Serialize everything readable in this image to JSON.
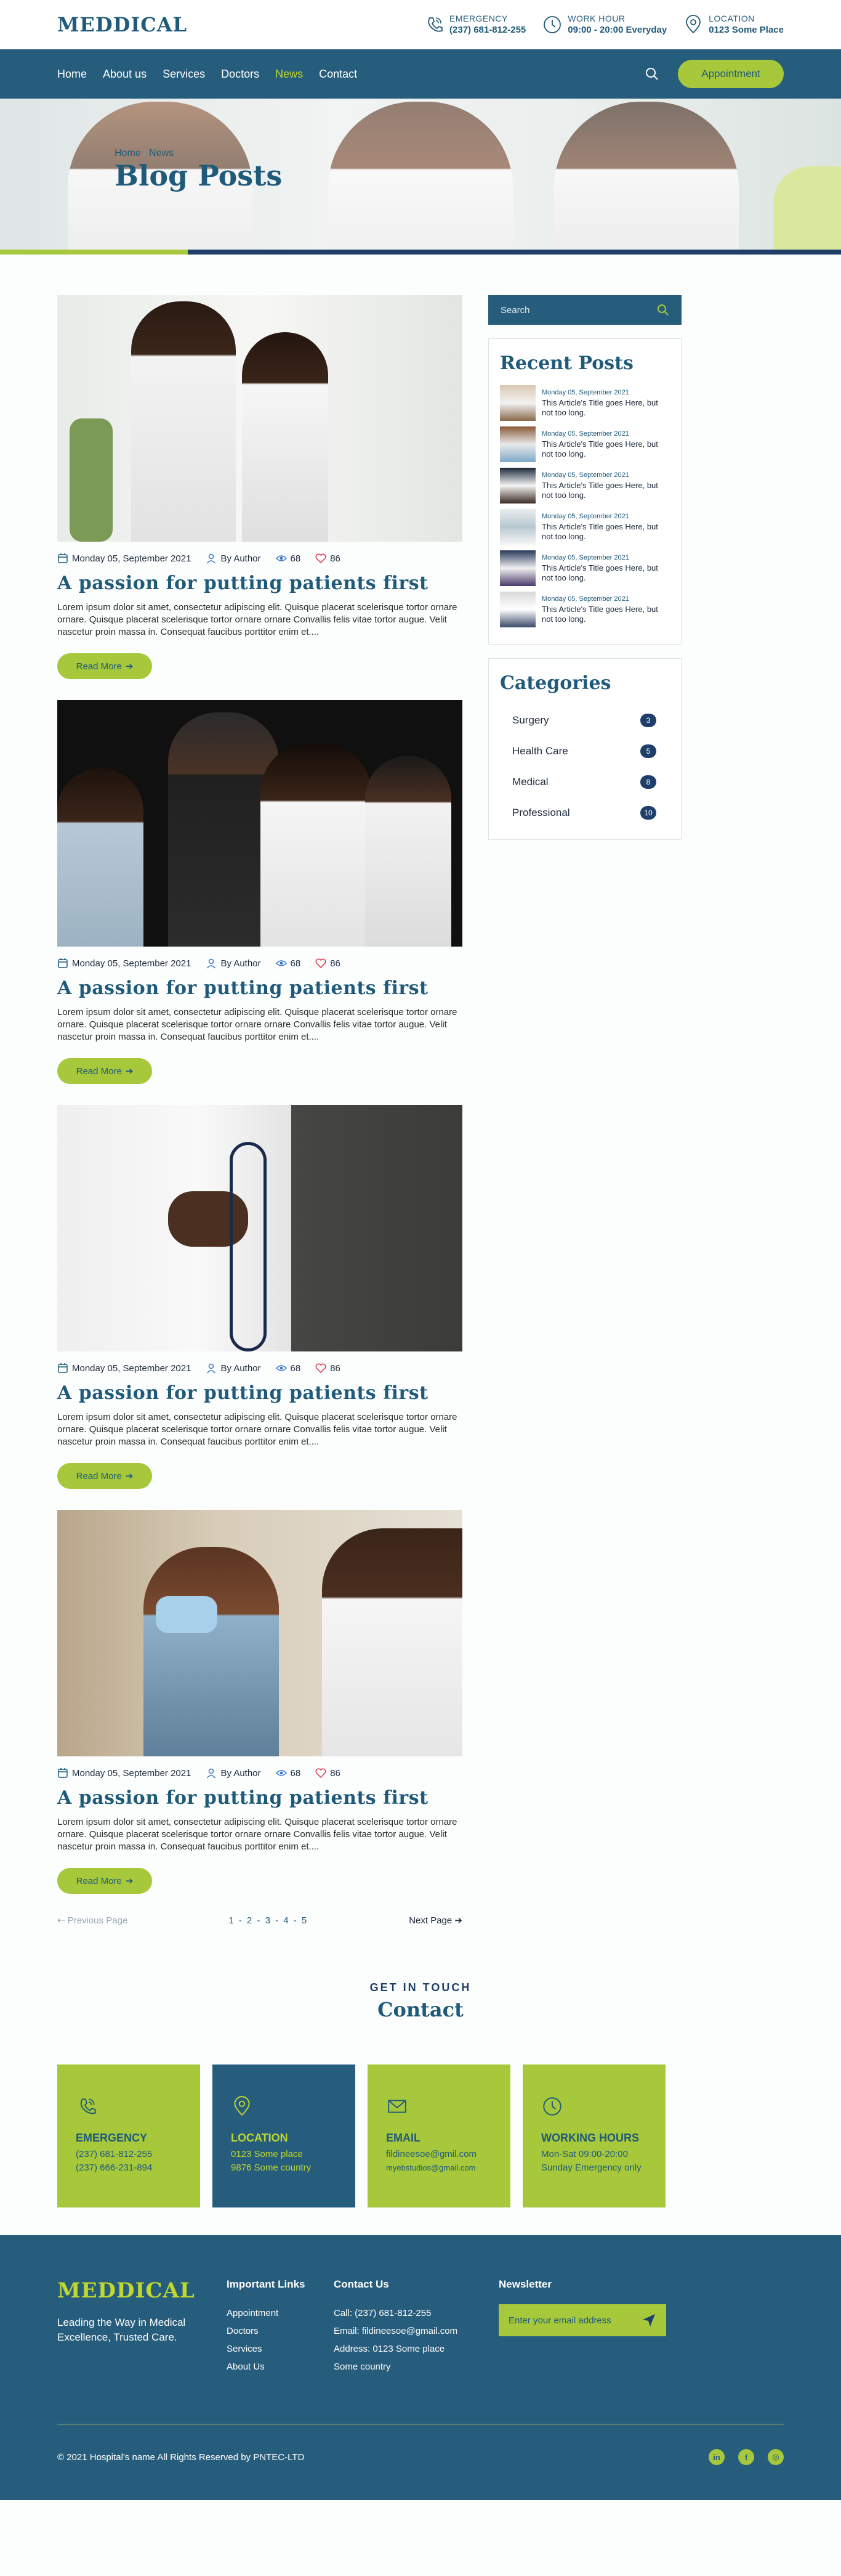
{
  "header": {
    "logo": "MEDDICAL",
    "emergency_title": "EMERGENCY",
    "emergency_value": "(237) 681-812-255",
    "work_title": "WORK HOUR",
    "work_value": "09:00 - 20:00 Everyday",
    "location_title": "LOCATION",
    "location_value": "0123 Some Place"
  },
  "nav": {
    "items": [
      "Home",
      "About us",
      "Services",
      "Doctors",
      "News",
      "Contact"
    ],
    "active": "News",
    "appointment": "Appointment"
  },
  "hero": {
    "crumb_home": "Home",
    "crumb_sep": " / ",
    "crumb_current": "News",
    "title": "Blog Posts"
  },
  "posts": [
    {
      "date": "Monday 05, September 2021",
      "author": "By Author",
      "views": "68",
      "likes": "86",
      "title": "A passion for putting patients first",
      "excerpt": "Lorem ipsum dolor sit amet, consectetur adipiscing elit. Quisque placerat scelerisque tortor ornare ornare. Quisque placerat scelerisque tortor ornare ornare Convallis felis vitae tortor augue. Velit nascetur proin massa in. Consequat faucibus porttitor enim et....",
      "read_more": "Read More"
    },
    {
      "date": "Monday 05, September 2021",
      "author": "By Author",
      "views": "68",
      "likes": "86",
      "title": "A passion for putting patients first",
      "excerpt": "Lorem ipsum dolor sit amet, consectetur adipiscing elit. Quisque placerat scelerisque tortor ornare ornare. Quisque placerat scelerisque tortor ornare ornare Convallis felis vitae tortor augue. Velit nascetur proin massa in. Consequat faucibus porttitor enim et....",
      "read_more": "Read More"
    },
    {
      "date": "Monday 05, September 2021",
      "author": "By Author",
      "views": "68",
      "likes": "86",
      "title": "A passion for putting patients first",
      "excerpt": "Lorem ipsum dolor sit amet, consectetur adipiscing elit. Quisque placerat scelerisque tortor ornare ornare. Quisque placerat scelerisque tortor ornare ornare Convallis felis vitae tortor augue. Velit nascetur proin massa in. Consequat faucibus porttitor enim et....",
      "read_more": "Read More"
    },
    {
      "date": "Monday 05, September 2021",
      "author": "By Author",
      "views": "68",
      "likes": "86",
      "title": "A passion for putting patients first",
      "excerpt": "Lorem ipsum dolor sit amet, consectetur adipiscing elit. Quisque placerat scelerisque tortor ornare ornare. Quisque placerat scelerisque tortor ornare ornare Convallis felis vitae tortor augue. Velit nascetur proin massa in. Consequat faucibus porttitor enim et....",
      "read_more": "Read More"
    }
  ],
  "pagination": {
    "prev": "Previous Page",
    "pages": "1 - 2 - 3 - 4 - 5",
    "next": "Next Page"
  },
  "sidebar": {
    "search_placeholder": "Search",
    "recent_title": "Recent Posts",
    "recent": [
      {
        "date": "Monday 05, September 2021",
        "title": "This Article's Title goes Here, but not too long."
      },
      {
        "date": "Monday 05, September 2021",
        "title": "This Article's Title goes Here, but not too long."
      },
      {
        "date": "Monday 05, September 2021",
        "title": "This Article's Title goes Here, but not too long."
      },
      {
        "date": "Monday 05, September 2021",
        "title": "This Article's Title goes Here, but not too long."
      },
      {
        "date": "Monday 05, September 2021",
        "title": "This Article's Title goes Here, but not too long."
      },
      {
        "date": "Monday 05, September 2021",
        "title": "This Article's Title goes Here, but not too long."
      }
    ],
    "categories_title": "Categories",
    "categories": [
      {
        "name": "Surgery",
        "count": "3"
      },
      {
        "name": "Health Care",
        "count": "5"
      },
      {
        "name": "Medical",
        "count": "8"
      },
      {
        "name": "Professional",
        "count": "10"
      }
    ]
  },
  "contact": {
    "kicker": "GET IN TOUCH",
    "title": "Contact",
    "boxes": [
      {
        "title": "EMERGENCY",
        "line1": "(237) 681-812-255",
        "line2": "(237) 666-231-894"
      },
      {
        "title": "LOCATION",
        "line1": "0123 Some place",
        "line2": "9876 Some country"
      },
      {
        "title": "EMAIL",
        "line1": "fildineesoe@gmil.com",
        "line2": "myebstudios@gmail.com"
      },
      {
        "title": "WORKING HOURS",
        "line1": "Mon-Sat 09:00-20:00",
        "line2": "Sunday Emergency only"
      }
    ]
  },
  "footer": {
    "logo": "MEDDICAL",
    "tagline": "Leading the Way in Medical Excellence, Trusted Care.",
    "links_title": "Important Links",
    "links": [
      "Appointment",
      "Doctors",
      "Services",
      "About Us"
    ],
    "contact_title": "Contact Us",
    "contact_lines": [
      "Call: (237) 681-812-255",
      "Email: fildineesoe@gmail.com",
      "Address: 0123 Some place",
      "Some country"
    ],
    "newsletter_title": "Newsletter",
    "newsletter_placeholder": "Enter your email address",
    "copyright": "© 2021 Hospital's name All Rights Reserved by PNTEC-LTD",
    "social": [
      "in",
      "f",
      "◎"
    ]
  },
  "colors": {
    "primary": "#275d7c",
    "accent": "#a6c83a",
    "dark": "#1f3f6a"
  }
}
